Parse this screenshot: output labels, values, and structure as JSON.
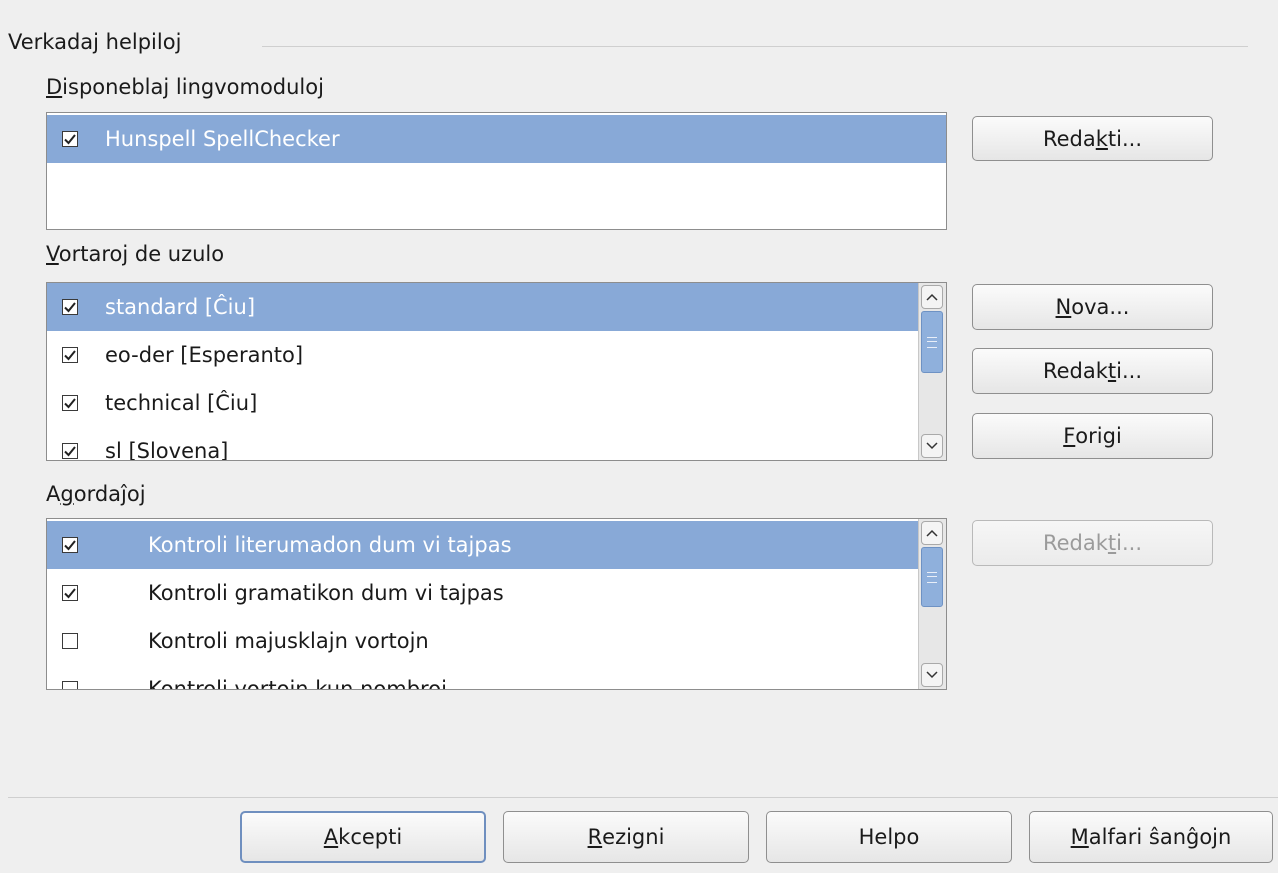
{
  "group_title": "Verkadaj helpiloj",
  "modules": {
    "label_pre": "",
    "label_u": "D",
    "label_post": "isponeblaj lingvomoduloj",
    "items": [
      {
        "text": "Hunspell SpellChecker",
        "checked": true,
        "selected": true
      }
    ],
    "edit_button": {
      "pre": "Reda",
      "u": "k",
      "post": "ti..."
    }
  },
  "dictionaries": {
    "label_pre": "",
    "label_u": "V",
    "label_post": "ortaroj de uzulo",
    "items": [
      {
        "text": "standard [Ĉiu]",
        "checked": true,
        "selected": true
      },
      {
        "text": "eo-der [Esperanto]",
        "checked": true,
        "selected": false
      },
      {
        "text": "technical [Ĉiu]",
        "checked": true,
        "selected": false
      },
      {
        "text": "sl [Slovena]",
        "checked": true,
        "selected": false
      }
    ],
    "new_button": {
      "pre": "",
      "u": "N",
      "post": "ova..."
    },
    "edit_button": {
      "pre": "Redak",
      "u": "t",
      "post": "i..."
    },
    "delete_button": {
      "pre": "",
      "u": "F",
      "post": "origi"
    }
  },
  "options": {
    "label_pre": "A",
    "label_u": "g",
    "label_post": "ordaĵoj",
    "items": [
      {
        "text": "Kontroli literumadon dum vi tajpas",
        "checked": true,
        "selected": true
      },
      {
        "text": "Kontroli gramatikon dum vi tajpas",
        "checked": true,
        "selected": false
      },
      {
        "text": "Kontroli majusklajn vortojn",
        "checked": false,
        "selected": false
      },
      {
        "text": "Kontroli vortojn kun nombroj",
        "checked": false,
        "selected": false
      }
    ],
    "edit_button": {
      "pre": "Redak",
      "u": "t",
      "post": "i..."
    }
  },
  "footer": {
    "ok": {
      "pre": "",
      "u": "A",
      "post": "kcepti"
    },
    "cancel": {
      "pre": "",
      "u": "R",
      "post": "ezigni"
    },
    "help": {
      "pre": "Helpo",
      "u": "",
      "post": ""
    },
    "reset": {
      "pre": "",
      "u": "M",
      "post": "alfari ŝanĝojn"
    }
  },
  "colors": {
    "selection": "#88a9d7",
    "background": "#efefef"
  }
}
